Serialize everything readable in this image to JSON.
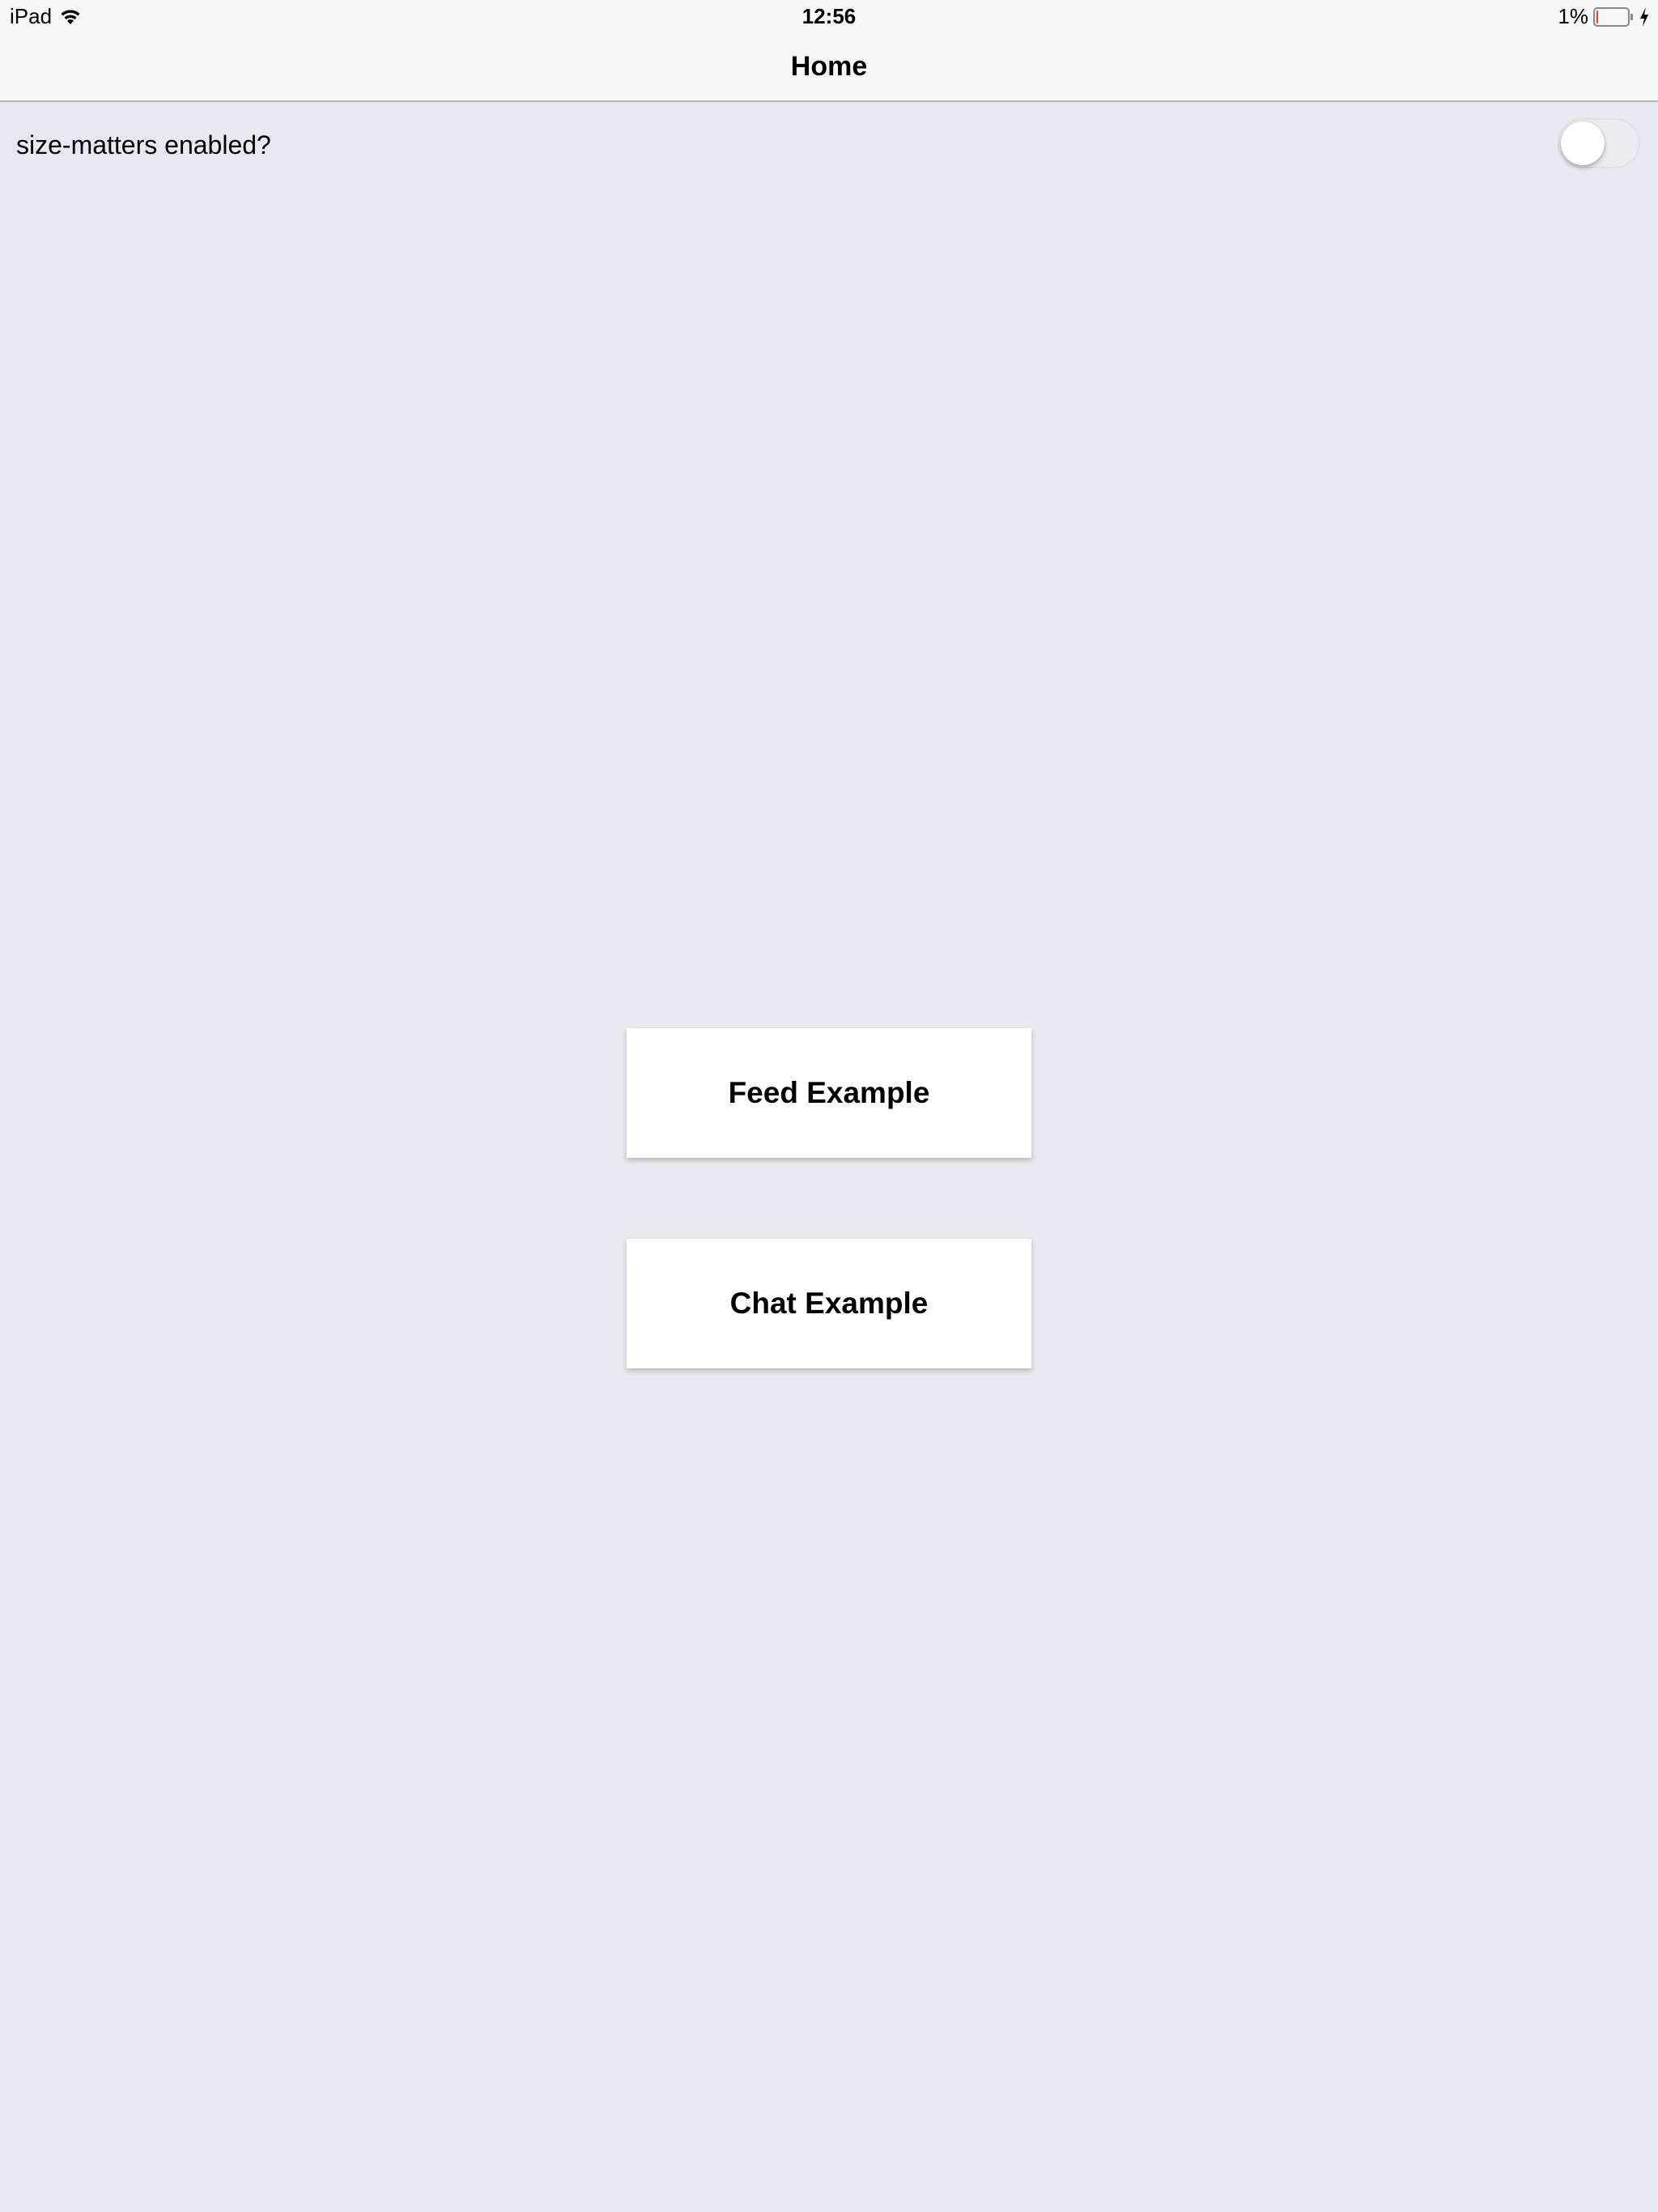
{
  "status_bar": {
    "device": "iPad",
    "time": "12:56",
    "battery_percent": "1%",
    "battery_level": 0.01,
    "icons": [
      "wifi-icon",
      "battery-icon",
      "charging-bolt-icon"
    ]
  },
  "nav": {
    "title": "Home"
  },
  "settings": {
    "size_matters_label": "size-matters enabled?",
    "size_matters_enabled": false
  },
  "buttons": {
    "feed_label": "Feed Example",
    "chat_label": "Chat Example"
  },
  "colors": {
    "background": "#e9e8ef",
    "nav_background": "#f7f7f7",
    "button_background": "#ffffff",
    "battery_low": "#ff3b30"
  }
}
